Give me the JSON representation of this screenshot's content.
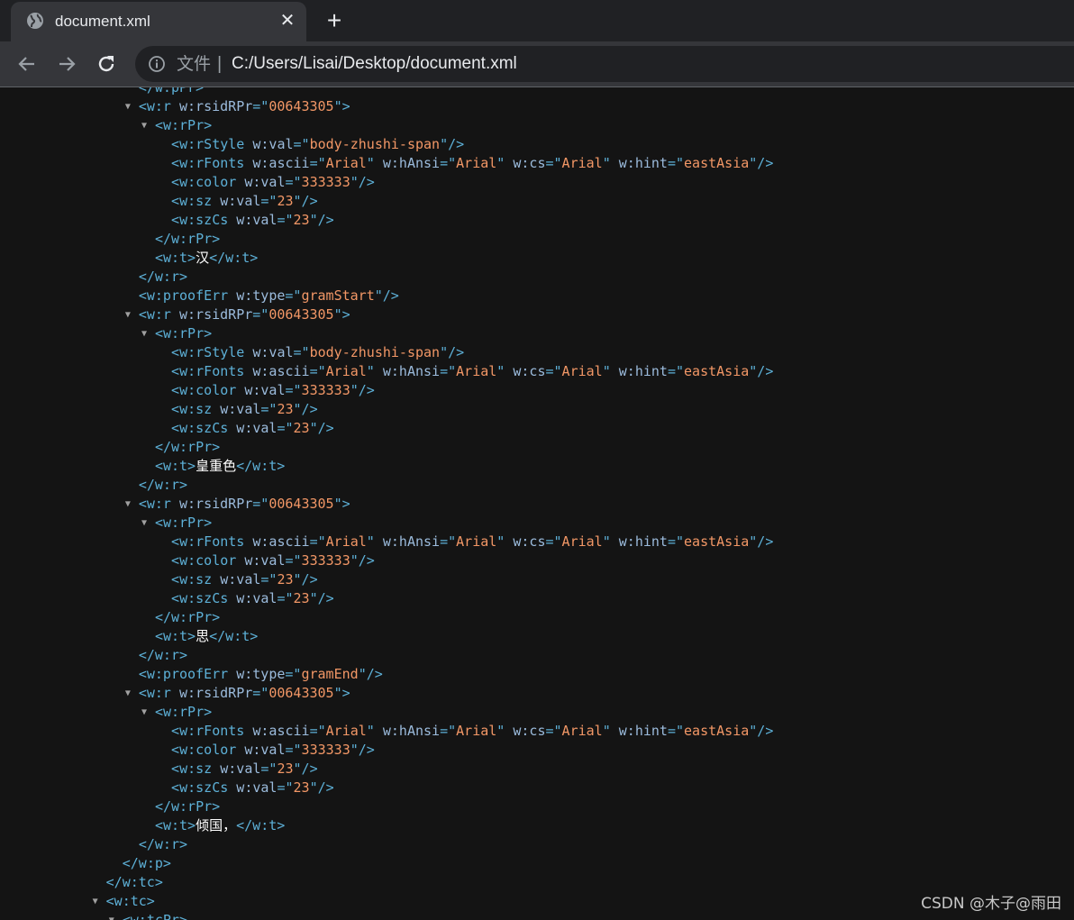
{
  "browser": {
    "tab_title": "document.xml",
    "tab_close": "✕",
    "new_tab": "+",
    "address": {
      "scheme_label": "文件",
      "separator": "|",
      "url": "C:/Users/Lisai/Desktop/document.xml"
    }
  },
  "xml_lines": [
    {
      "indent": 8,
      "arrow": "",
      "parts": [
        {
          "c": "t",
          "s": "</w:pPr>"
        }
      ]
    },
    {
      "indent": 8,
      "arrow": "▼",
      "parts": [
        {
          "c": "t",
          "s": "<w:r "
        },
        {
          "c": "a",
          "s": "w:rsidRPr"
        },
        {
          "c": "t",
          "s": "=\""
        },
        {
          "c": "v",
          "s": "00643305"
        },
        {
          "c": "t",
          "s": "\">"
        }
      ]
    },
    {
      "indent": 9,
      "arrow": "▼",
      "parts": [
        {
          "c": "t",
          "s": "<w:rPr>"
        }
      ]
    },
    {
      "indent": 10,
      "arrow": "",
      "parts": [
        {
          "c": "t",
          "s": "<w:rStyle "
        },
        {
          "c": "a",
          "s": "w:val"
        },
        {
          "c": "t",
          "s": "=\""
        },
        {
          "c": "v",
          "s": "body-zhushi-span"
        },
        {
          "c": "t",
          "s": "\"/>"
        }
      ]
    },
    {
      "indent": 10,
      "arrow": "",
      "parts": [
        {
          "c": "t",
          "s": "<w:rFonts "
        },
        {
          "c": "a",
          "s": "w:ascii"
        },
        {
          "c": "t",
          "s": "=\""
        },
        {
          "c": "v",
          "s": "Arial"
        },
        {
          "c": "t",
          "s": "\" "
        },
        {
          "c": "a",
          "s": "w:hAnsi"
        },
        {
          "c": "t",
          "s": "=\""
        },
        {
          "c": "v",
          "s": "Arial"
        },
        {
          "c": "t",
          "s": "\" "
        },
        {
          "c": "a",
          "s": "w:cs"
        },
        {
          "c": "t",
          "s": "=\""
        },
        {
          "c": "v",
          "s": "Arial"
        },
        {
          "c": "t",
          "s": "\" "
        },
        {
          "c": "a",
          "s": "w:hint"
        },
        {
          "c": "t",
          "s": "=\""
        },
        {
          "c": "v",
          "s": "eastAsia"
        },
        {
          "c": "t",
          "s": "\"/>"
        }
      ]
    },
    {
      "indent": 10,
      "arrow": "",
      "parts": [
        {
          "c": "t",
          "s": "<w:color "
        },
        {
          "c": "a",
          "s": "w:val"
        },
        {
          "c": "t",
          "s": "=\""
        },
        {
          "c": "v",
          "s": "333333"
        },
        {
          "c": "t",
          "s": "\"/>"
        }
      ]
    },
    {
      "indent": 10,
      "arrow": "",
      "parts": [
        {
          "c": "t",
          "s": "<w:sz "
        },
        {
          "c": "a",
          "s": "w:val"
        },
        {
          "c": "t",
          "s": "=\""
        },
        {
          "c": "v",
          "s": "23"
        },
        {
          "c": "t",
          "s": "\"/>"
        }
      ]
    },
    {
      "indent": 10,
      "arrow": "",
      "parts": [
        {
          "c": "t",
          "s": "<w:szCs "
        },
        {
          "c": "a",
          "s": "w:val"
        },
        {
          "c": "t",
          "s": "=\""
        },
        {
          "c": "v",
          "s": "23"
        },
        {
          "c": "t",
          "s": "\"/>"
        }
      ]
    },
    {
      "indent": 9,
      "arrow": "",
      "parts": [
        {
          "c": "t",
          "s": "</w:rPr>"
        }
      ]
    },
    {
      "indent": 9,
      "arrow": "",
      "parts": [
        {
          "c": "t",
          "s": "<w:t>"
        },
        {
          "c": "x",
          "s": "汉"
        },
        {
          "c": "t",
          "s": "</w:t>"
        }
      ]
    },
    {
      "indent": 8,
      "arrow": "",
      "parts": [
        {
          "c": "t",
          "s": "</w:r>"
        }
      ]
    },
    {
      "indent": 8,
      "arrow": "",
      "parts": [
        {
          "c": "t",
          "s": "<w:proofErr "
        },
        {
          "c": "a",
          "s": "w:type"
        },
        {
          "c": "t",
          "s": "=\""
        },
        {
          "c": "v",
          "s": "gramStart"
        },
        {
          "c": "t",
          "s": "\"/>"
        }
      ]
    },
    {
      "indent": 8,
      "arrow": "▼",
      "parts": [
        {
          "c": "t",
          "s": "<w:r "
        },
        {
          "c": "a",
          "s": "w:rsidRPr"
        },
        {
          "c": "t",
          "s": "=\""
        },
        {
          "c": "v",
          "s": "00643305"
        },
        {
          "c": "t",
          "s": "\">"
        }
      ]
    },
    {
      "indent": 9,
      "arrow": "▼",
      "parts": [
        {
          "c": "t",
          "s": "<w:rPr>"
        }
      ]
    },
    {
      "indent": 10,
      "arrow": "",
      "parts": [
        {
          "c": "t",
          "s": "<w:rStyle "
        },
        {
          "c": "a",
          "s": "w:val"
        },
        {
          "c": "t",
          "s": "=\""
        },
        {
          "c": "v",
          "s": "body-zhushi-span"
        },
        {
          "c": "t",
          "s": "\"/>"
        }
      ]
    },
    {
      "indent": 10,
      "arrow": "",
      "parts": [
        {
          "c": "t",
          "s": "<w:rFonts "
        },
        {
          "c": "a",
          "s": "w:ascii"
        },
        {
          "c": "t",
          "s": "=\""
        },
        {
          "c": "v",
          "s": "Arial"
        },
        {
          "c": "t",
          "s": "\" "
        },
        {
          "c": "a",
          "s": "w:hAnsi"
        },
        {
          "c": "t",
          "s": "=\""
        },
        {
          "c": "v",
          "s": "Arial"
        },
        {
          "c": "t",
          "s": "\" "
        },
        {
          "c": "a",
          "s": "w:cs"
        },
        {
          "c": "t",
          "s": "=\""
        },
        {
          "c": "v",
          "s": "Arial"
        },
        {
          "c": "t",
          "s": "\" "
        },
        {
          "c": "a",
          "s": "w:hint"
        },
        {
          "c": "t",
          "s": "=\""
        },
        {
          "c": "v",
          "s": "eastAsia"
        },
        {
          "c": "t",
          "s": "\"/>"
        }
      ]
    },
    {
      "indent": 10,
      "arrow": "",
      "parts": [
        {
          "c": "t",
          "s": "<w:color "
        },
        {
          "c": "a",
          "s": "w:val"
        },
        {
          "c": "t",
          "s": "=\""
        },
        {
          "c": "v",
          "s": "333333"
        },
        {
          "c": "t",
          "s": "\"/>"
        }
      ]
    },
    {
      "indent": 10,
      "arrow": "",
      "parts": [
        {
          "c": "t",
          "s": "<w:sz "
        },
        {
          "c": "a",
          "s": "w:val"
        },
        {
          "c": "t",
          "s": "=\""
        },
        {
          "c": "v",
          "s": "23"
        },
        {
          "c": "t",
          "s": "\"/>"
        }
      ]
    },
    {
      "indent": 10,
      "arrow": "",
      "parts": [
        {
          "c": "t",
          "s": "<w:szCs "
        },
        {
          "c": "a",
          "s": "w:val"
        },
        {
          "c": "t",
          "s": "=\""
        },
        {
          "c": "v",
          "s": "23"
        },
        {
          "c": "t",
          "s": "\"/>"
        }
      ]
    },
    {
      "indent": 9,
      "arrow": "",
      "parts": [
        {
          "c": "t",
          "s": "</w:rPr>"
        }
      ]
    },
    {
      "indent": 9,
      "arrow": "",
      "parts": [
        {
          "c": "t",
          "s": "<w:t>"
        },
        {
          "c": "x",
          "s": "皇重色"
        },
        {
          "c": "t",
          "s": "</w:t>"
        }
      ]
    },
    {
      "indent": 8,
      "arrow": "",
      "parts": [
        {
          "c": "t",
          "s": "</w:r>"
        }
      ]
    },
    {
      "indent": 8,
      "arrow": "▼",
      "parts": [
        {
          "c": "t",
          "s": "<w:r "
        },
        {
          "c": "a",
          "s": "w:rsidRPr"
        },
        {
          "c": "t",
          "s": "=\""
        },
        {
          "c": "v",
          "s": "00643305"
        },
        {
          "c": "t",
          "s": "\">"
        }
      ]
    },
    {
      "indent": 9,
      "arrow": "▼",
      "parts": [
        {
          "c": "t",
          "s": "<w:rPr>"
        }
      ]
    },
    {
      "indent": 10,
      "arrow": "",
      "parts": [
        {
          "c": "t",
          "s": "<w:rFonts "
        },
        {
          "c": "a",
          "s": "w:ascii"
        },
        {
          "c": "t",
          "s": "=\""
        },
        {
          "c": "v",
          "s": "Arial"
        },
        {
          "c": "t",
          "s": "\" "
        },
        {
          "c": "a",
          "s": "w:hAnsi"
        },
        {
          "c": "t",
          "s": "=\""
        },
        {
          "c": "v",
          "s": "Arial"
        },
        {
          "c": "t",
          "s": "\" "
        },
        {
          "c": "a",
          "s": "w:cs"
        },
        {
          "c": "t",
          "s": "=\""
        },
        {
          "c": "v",
          "s": "Arial"
        },
        {
          "c": "t",
          "s": "\" "
        },
        {
          "c": "a",
          "s": "w:hint"
        },
        {
          "c": "t",
          "s": "=\""
        },
        {
          "c": "v",
          "s": "eastAsia"
        },
        {
          "c": "t",
          "s": "\"/>"
        }
      ]
    },
    {
      "indent": 10,
      "arrow": "",
      "parts": [
        {
          "c": "t",
          "s": "<w:color "
        },
        {
          "c": "a",
          "s": "w:val"
        },
        {
          "c": "t",
          "s": "=\""
        },
        {
          "c": "v",
          "s": "333333"
        },
        {
          "c": "t",
          "s": "\"/>"
        }
      ]
    },
    {
      "indent": 10,
      "arrow": "",
      "parts": [
        {
          "c": "t",
          "s": "<w:sz "
        },
        {
          "c": "a",
          "s": "w:val"
        },
        {
          "c": "t",
          "s": "=\""
        },
        {
          "c": "v",
          "s": "23"
        },
        {
          "c": "t",
          "s": "\"/>"
        }
      ]
    },
    {
      "indent": 10,
      "arrow": "",
      "parts": [
        {
          "c": "t",
          "s": "<w:szCs "
        },
        {
          "c": "a",
          "s": "w:val"
        },
        {
          "c": "t",
          "s": "=\""
        },
        {
          "c": "v",
          "s": "23"
        },
        {
          "c": "t",
          "s": "\"/>"
        }
      ]
    },
    {
      "indent": 9,
      "arrow": "",
      "parts": [
        {
          "c": "t",
          "s": "</w:rPr>"
        }
      ]
    },
    {
      "indent": 9,
      "arrow": "",
      "parts": [
        {
          "c": "t",
          "s": "<w:t>"
        },
        {
          "c": "x",
          "s": "思"
        },
        {
          "c": "t",
          "s": "</w:t>"
        }
      ]
    },
    {
      "indent": 8,
      "arrow": "",
      "parts": [
        {
          "c": "t",
          "s": "</w:r>"
        }
      ]
    },
    {
      "indent": 8,
      "arrow": "",
      "parts": [
        {
          "c": "t",
          "s": "<w:proofErr "
        },
        {
          "c": "a",
          "s": "w:type"
        },
        {
          "c": "t",
          "s": "=\""
        },
        {
          "c": "v",
          "s": "gramEnd"
        },
        {
          "c": "t",
          "s": "\"/>"
        }
      ]
    },
    {
      "indent": 8,
      "arrow": "▼",
      "parts": [
        {
          "c": "t",
          "s": "<w:r "
        },
        {
          "c": "a",
          "s": "w:rsidRPr"
        },
        {
          "c": "t",
          "s": "=\""
        },
        {
          "c": "v",
          "s": "00643305"
        },
        {
          "c": "t",
          "s": "\">"
        }
      ]
    },
    {
      "indent": 9,
      "arrow": "▼",
      "parts": [
        {
          "c": "t",
          "s": "<w:rPr>"
        }
      ]
    },
    {
      "indent": 10,
      "arrow": "",
      "parts": [
        {
          "c": "t",
          "s": "<w:rFonts "
        },
        {
          "c": "a",
          "s": "w:ascii"
        },
        {
          "c": "t",
          "s": "=\""
        },
        {
          "c": "v",
          "s": "Arial"
        },
        {
          "c": "t",
          "s": "\" "
        },
        {
          "c": "a",
          "s": "w:hAnsi"
        },
        {
          "c": "t",
          "s": "=\""
        },
        {
          "c": "v",
          "s": "Arial"
        },
        {
          "c": "t",
          "s": "\" "
        },
        {
          "c": "a",
          "s": "w:cs"
        },
        {
          "c": "t",
          "s": "=\""
        },
        {
          "c": "v",
          "s": "Arial"
        },
        {
          "c": "t",
          "s": "\" "
        },
        {
          "c": "a",
          "s": "w:hint"
        },
        {
          "c": "t",
          "s": "=\""
        },
        {
          "c": "v",
          "s": "eastAsia"
        },
        {
          "c": "t",
          "s": "\"/>"
        }
      ]
    },
    {
      "indent": 10,
      "arrow": "",
      "parts": [
        {
          "c": "t",
          "s": "<w:color "
        },
        {
          "c": "a",
          "s": "w:val"
        },
        {
          "c": "t",
          "s": "=\""
        },
        {
          "c": "v",
          "s": "333333"
        },
        {
          "c": "t",
          "s": "\"/>"
        }
      ]
    },
    {
      "indent": 10,
      "arrow": "",
      "parts": [
        {
          "c": "t",
          "s": "<w:sz "
        },
        {
          "c": "a",
          "s": "w:val"
        },
        {
          "c": "t",
          "s": "=\""
        },
        {
          "c": "v",
          "s": "23"
        },
        {
          "c": "t",
          "s": "\"/>"
        }
      ]
    },
    {
      "indent": 10,
      "arrow": "",
      "parts": [
        {
          "c": "t",
          "s": "<w:szCs "
        },
        {
          "c": "a",
          "s": "w:val"
        },
        {
          "c": "t",
          "s": "=\""
        },
        {
          "c": "v",
          "s": "23"
        },
        {
          "c": "t",
          "s": "\"/>"
        }
      ]
    },
    {
      "indent": 9,
      "arrow": "",
      "parts": [
        {
          "c": "t",
          "s": "</w:rPr>"
        }
      ]
    },
    {
      "indent": 9,
      "arrow": "",
      "parts": [
        {
          "c": "t",
          "s": "<w:t>"
        },
        {
          "c": "x",
          "s": "倾国，"
        },
        {
          "c": "t",
          "s": "</w:t>"
        }
      ]
    },
    {
      "indent": 8,
      "arrow": "",
      "parts": [
        {
          "c": "t",
          "s": "</w:r>"
        }
      ]
    },
    {
      "indent": 7,
      "arrow": "",
      "parts": [
        {
          "c": "t",
          "s": "</w:p>"
        }
      ]
    },
    {
      "indent": 6,
      "arrow": "",
      "parts": [
        {
          "c": "t",
          "s": "</w:tc>"
        }
      ]
    },
    {
      "indent": 6,
      "arrow": "▼",
      "parts": [
        {
          "c": "t",
          "s": "<w:tc>"
        }
      ]
    },
    {
      "indent": 7,
      "arrow": "▼",
      "parts": [
        {
          "c": "t",
          "s": "<w:tcPr>"
        }
      ]
    }
  ],
  "watermark": "CSDN @木子@雨田",
  "colors": {
    "tag": "#5db0d7",
    "attribute": "#9bbbdc",
    "value": "#f29766",
    "text": "#ffffff",
    "background": "#141414"
  }
}
